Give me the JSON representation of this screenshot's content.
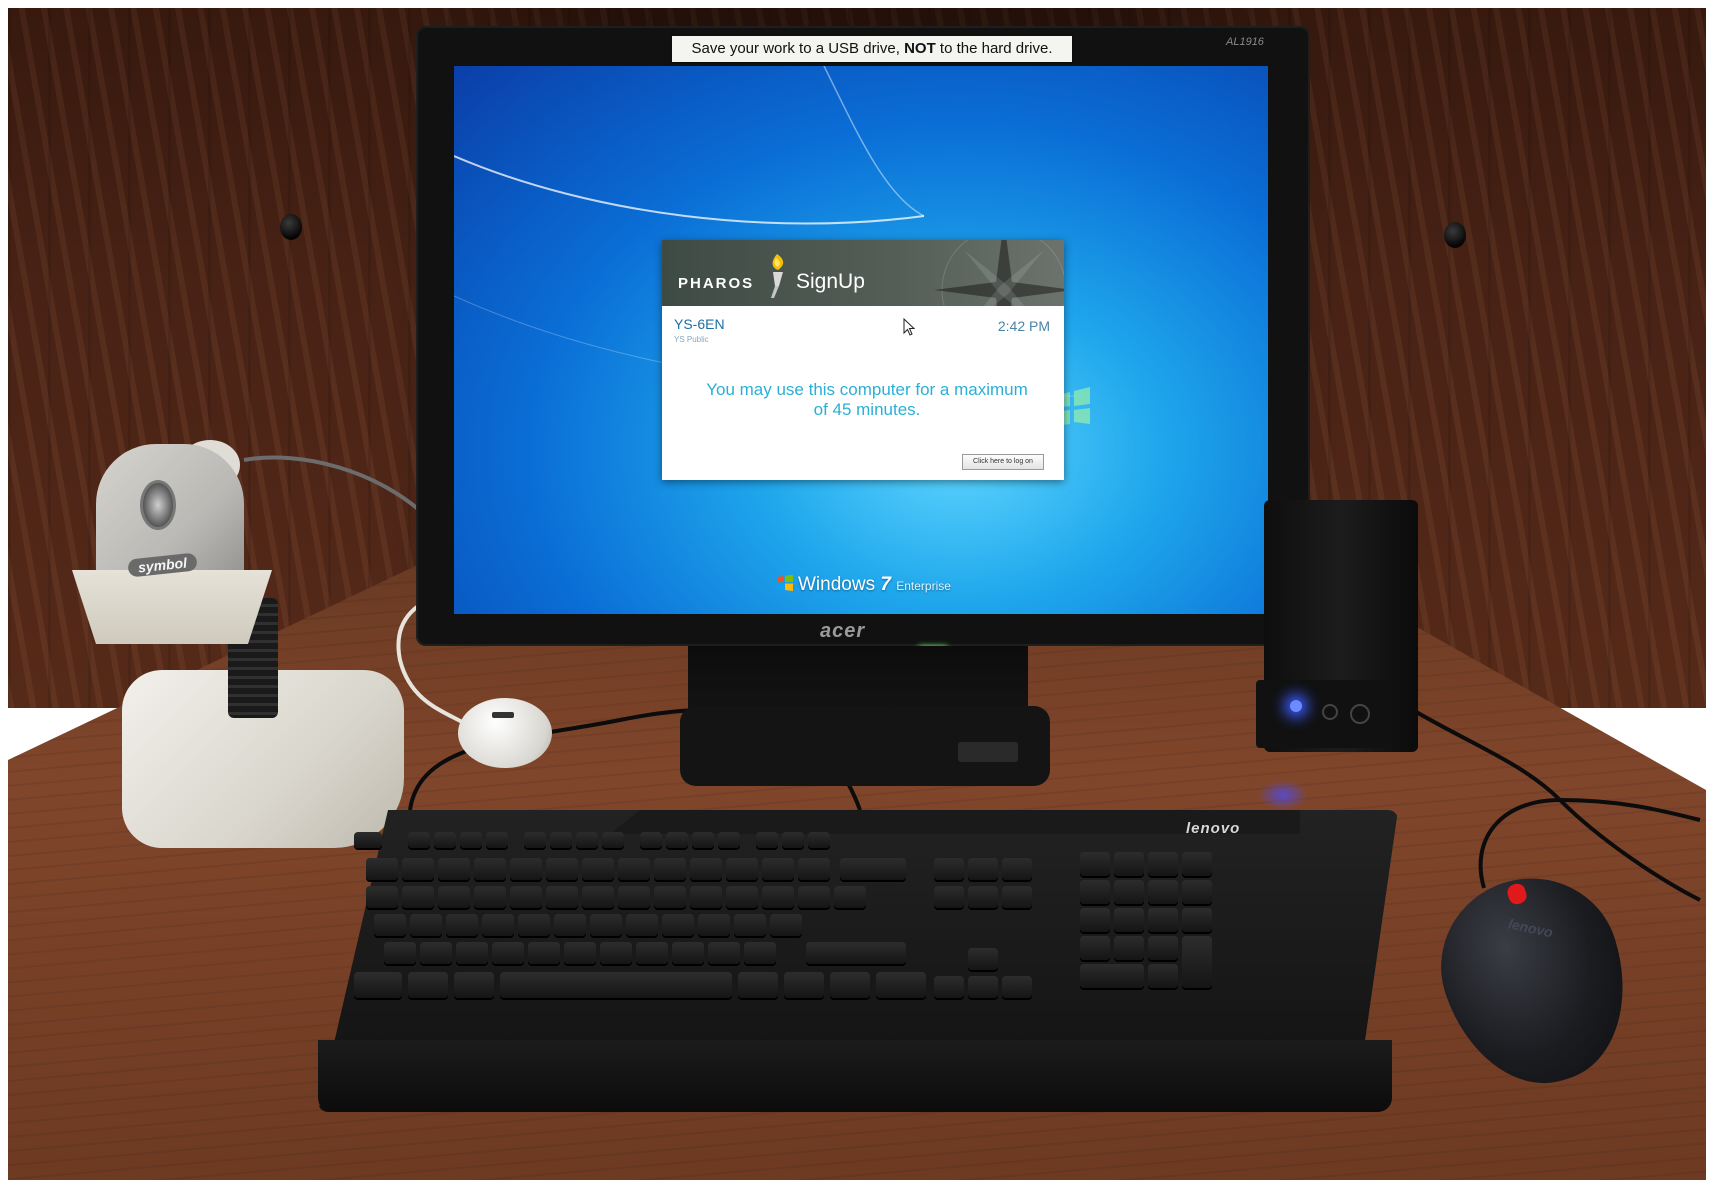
{
  "monitor": {
    "sticky_note_prefix": "Save your work to a USB drive,",
    "sticky_note_bold": "NOT",
    "sticky_note_suffix": "to the hard drive.",
    "model_label": "AL1916",
    "brand_label": "acer"
  },
  "dialog": {
    "brand": "PHAROS",
    "product": "SignUp",
    "station_id": "YS-6EN",
    "station_group": "YS Public",
    "time": "2:42 PM",
    "message": "You may use this computer for a maximum of 45 minutes.",
    "login_button": "Click here to log on"
  },
  "desktop": {
    "os_name": "Windows",
    "os_version": "7",
    "os_edition": "Enterprise"
  },
  "devices": {
    "scanner_brand": "symbol",
    "keyboard_brand": "lenovo",
    "mouse_brand": "lenovo"
  }
}
